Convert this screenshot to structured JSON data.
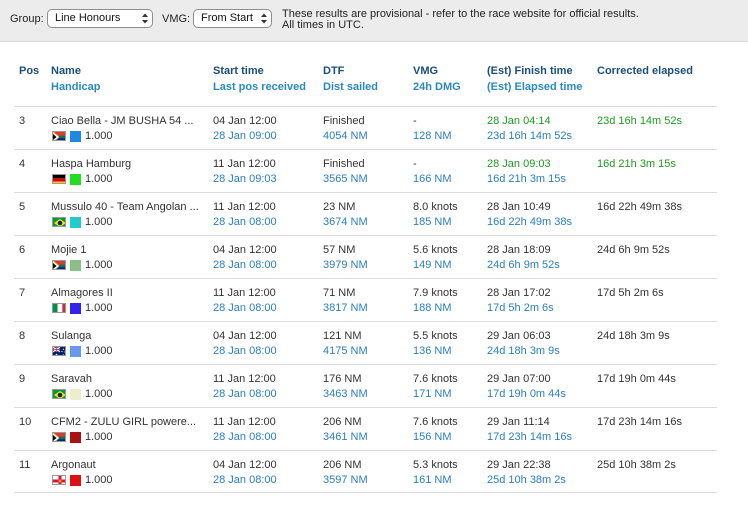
{
  "toolbar": {
    "group_label": "Group:",
    "group_value": "Line Honours",
    "vmg_label": "VMG:",
    "vmg_value": "From Start",
    "notice_line1": "These results are provisional - refer to the race website for official results.",
    "notice_line2": "All times in UTC."
  },
  "headers": {
    "pos": "Pos",
    "name": "Name",
    "handicap": "Handicap",
    "start_time": "Start time",
    "last_pos": "Last pos received",
    "dtf": "DTF",
    "dist_sailed": "Dist sailed",
    "vmg": "VMG",
    "dmg": "24h DMG",
    "finish_time": "(Est) Finish time",
    "elapsed_time": "(Est) Elapsed time",
    "corrected": "Corrected elapsed"
  },
  "rows": [
    {
      "pos": "3",
      "name": "Ciao Bella - JM BUSHA 54 ...",
      "flag": "za",
      "color": "#1e88e5",
      "handicap": "1.000",
      "start": "04 Jan 12:00",
      "last_pos": "28 Jan 09:00",
      "dtf": "Finished",
      "dist": "4054 NM",
      "vmg": "-",
      "dmg": "128 NM",
      "finish": "28 Jan 04:14",
      "elapsed": "23d 16h 14m 52s",
      "corrected": "23d 16h 14m 52s",
      "finished": true
    },
    {
      "pos": "4",
      "name": "Haspa Hamburg",
      "flag": "de",
      "color": "#22dd22",
      "handicap": "1.000",
      "start": "11 Jan 12:00",
      "last_pos": "28 Jan 09:03",
      "dtf": "Finished",
      "dist": "3565 NM",
      "vmg": "-",
      "dmg": "166 NM",
      "finish": "28 Jan 09:03",
      "elapsed": "16d 21h 3m 15s",
      "corrected": "16d 21h 3m 15s",
      "finished": true
    },
    {
      "pos": "5",
      "name": "Mussulo 40 - Team Angolan ...",
      "flag": "br",
      "color": "#22cccc",
      "handicap": "1.000",
      "start": "11 Jan 12:00",
      "last_pos": "28 Jan 08:00",
      "dtf": "23 NM",
      "dist": "3674 NM",
      "vmg": "8.0 knots",
      "dmg": "185 NM",
      "finish": "28 Jan 10:49",
      "elapsed": "16d 22h 49m 38s",
      "corrected": "16d 22h 49m 38s",
      "finished": false
    },
    {
      "pos": "6",
      "name": "Mojie 1",
      "flag": "za",
      "color": "#88c088",
      "handicap": "1.000",
      "start": "04 Jan 12:00",
      "last_pos": "28 Jan 08:00",
      "dtf": "57 NM",
      "dist": "3979 NM",
      "vmg": "5.6 knots",
      "dmg": "149 NM",
      "finish": "28 Jan 18:09",
      "elapsed": "24d 6h 9m 52s",
      "corrected": "24d 6h 9m 52s",
      "finished": false
    },
    {
      "pos": "7",
      "name": "Almagores II",
      "flag": "it",
      "color": "#3322ee",
      "handicap": "1.000",
      "start": "11 Jan 12:00",
      "last_pos": "28 Jan 08:00",
      "dtf": "71 NM",
      "dist": "3817 NM",
      "vmg": "7.9 knots",
      "dmg": "188 NM",
      "finish": "28 Jan 17:02",
      "elapsed": "17d 5h 2m 6s",
      "corrected": "17d 5h 2m 6s",
      "finished": false
    },
    {
      "pos": "8",
      "name": "Sulanga",
      "flag": "au",
      "color": "#6699ee",
      "handicap": "1.000",
      "start": "04 Jan 12:00",
      "last_pos": "28 Jan 08:00",
      "dtf": "121 NM",
      "dist": "4175 NM",
      "vmg": "5.5 knots",
      "dmg": "136 NM",
      "finish": "29 Jan 06:03",
      "elapsed": "24d 18h 3m 9s",
      "corrected": "24d 18h 3m 9s",
      "finished": false
    },
    {
      "pos": "9",
      "name": "Saravah",
      "flag": "br",
      "color": "#eeeecc",
      "handicap": "1.000",
      "start": "11 Jan 12:00",
      "last_pos": "28 Jan 08:00",
      "dtf": "176 NM",
      "dist": "3463 NM",
      "vmg": "7.6 knots",
      "dmg": "171 NM",
      "finish": "29 Jan 07:00",
      "elapsed": "17d 19h 0m 44s",
      "corrected": "17d 19h 0m 44s",
      "finished": false
    },
    {
      "pos": "10",
      "name": "CFM2 - ZULU GIRL powere...",
      "flag": "za",
      "color": "#aa1111",
      "handicap": "1.000",
      "start": "11 Jan 12:00",
      "last_pos": "28 Jan 08:00",
      "dtf": "206 NM",
      "dist": "3461 NM",
      "vmg": "7.6 knots",
      "dmg": "156 NM",
      "finish": "29 Jan 11:14",
      "elapsed": "17d 23h 14m 16s",
      "corrected": "17d 23h 14m 16s",
      "finished": false
    },
    {
      "pos": "11",
      "name": "Argonaut",
      "flag": "gg",
      "color": "#dd1111",
      "handicap": "1.000",
      "start": "04 Jan 12:00",
      "last_pos": "28 Jan 08:00",
      "dtf": "206 NM",
      "dist": "3597 NM",
      "vmg": "5.3 knots",
      "dmg": "161 NM",
      "finish": "29 Jan 22:38",
      "elapsed": "25d 10h 38m 2s",
      "corrected": "25d 10h 38m 2s",
      "finished": false
    }
  ]
}
